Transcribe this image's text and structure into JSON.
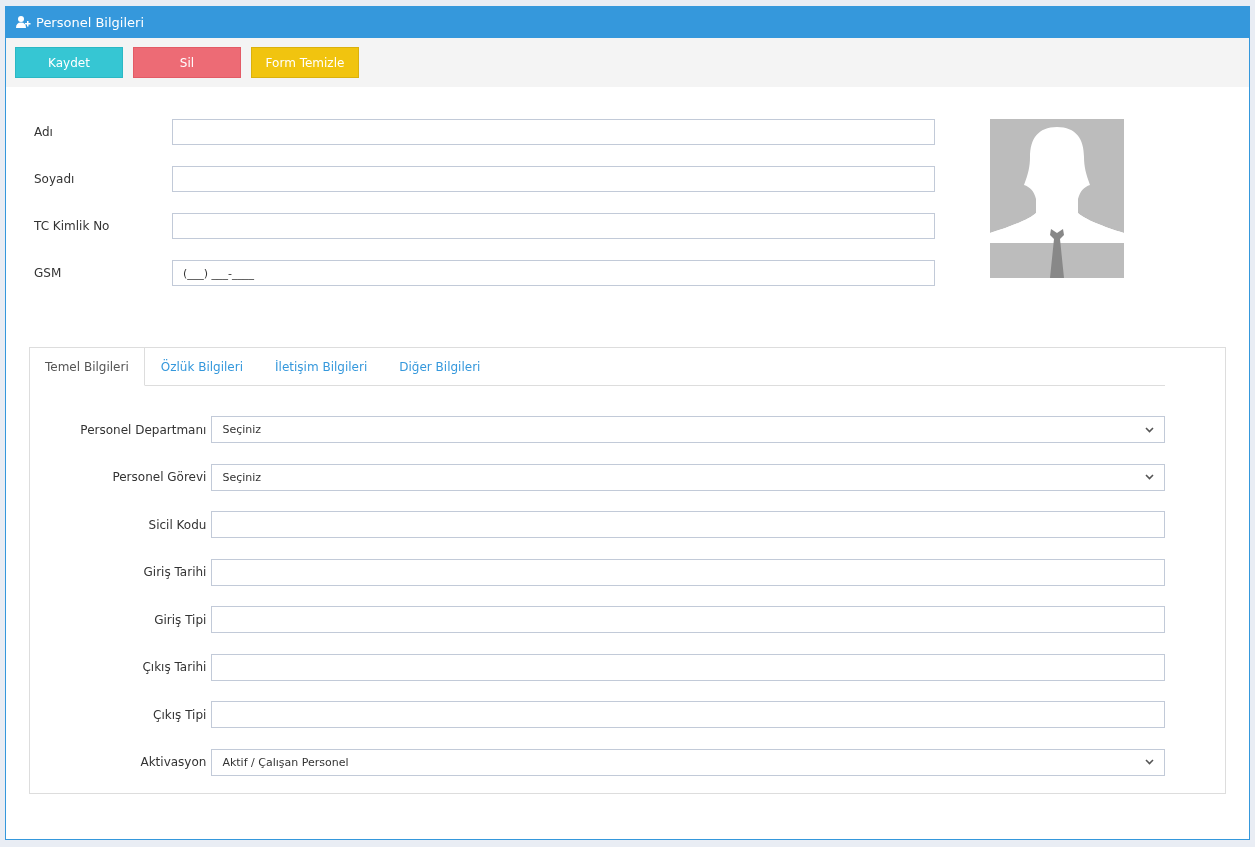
{
  "panel": {
    "title": "Personel Bilgileri"
  },
  "buttons": [
    {
      "label": "Kaydet",
      "kind": "primary"
    },
    {
      "label": "Sil",
      "kind": "danger"
    },
    {
      "label": "Form Temizle",
      "kind": "warning"
    }
  ],
  "top_fields": [
    {
      "label": "Adı"
    },
    {
      "label": "Soyadı"
    },
    {
      "label": "TC Kimlik No"
    },
    {
      "label": "GSM",
      "value": "(___) ___-____"
    }
  ],
  "tabs": [
    {
      "label": "Temel Bilgileri",
      "selected": true
    },
    {
      "label": "Özlük Bilgileri",
      "selected": false
    },
    {
      "label": "İletişim Bilgileri",
      "selected": false
    },
    {
      "label": "Diğer Bilgileri",
      "selected": false
    }
  ],
  "tab_fields": [
    {
      "label": "Personel Departmanı",
      "kind": "select",
      "value": "Seçiniz"
    },
    {
      "label": "Personel Görevi",
      "kind": "select",
      "value": "Seçiniz"
    },
    {
      "label": "Sicil Kodu",
      "kind": "text"
    },
    {
      "label": "Giriş Tarihi",
      "kind": "text"
    },
    {
      "label": "Giriş Tipi",
      "kind": "text"
    },
    {
      "label": "Çıkış Tarihi",
      "kind": "text"
    },
    {
      "label": "Çıkış Tipi",
      "kind": "text"
    },
    {
      "label": "Aktivasyon",
      "kind": "select",
      "value": "Aktif / Çalışan Personel"
    }
  ]
}
